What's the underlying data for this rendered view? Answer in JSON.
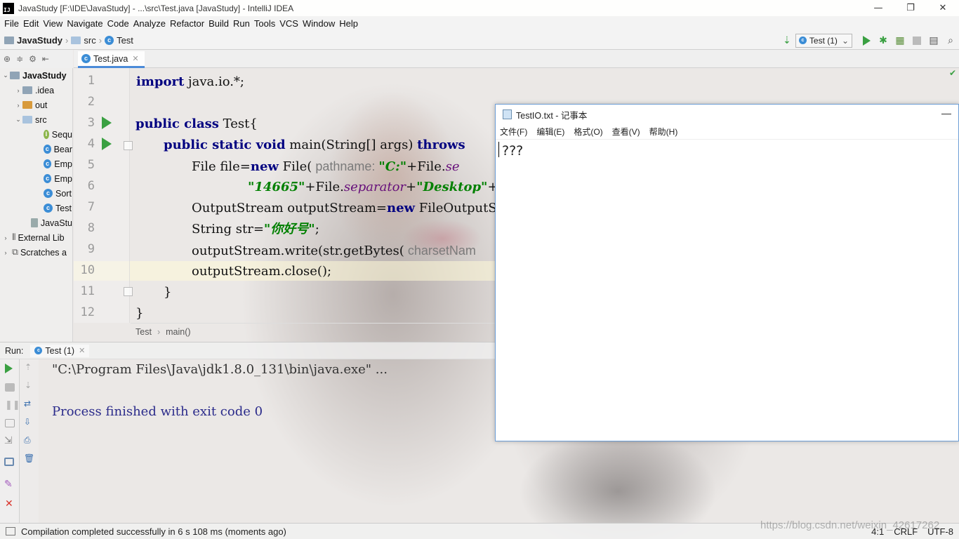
{
  "window": {
    "title": "JavaStudy [F:\\IDE\\JavaStudy] - ...\\src\\Test.java [JavaStudy] - IntelliJ IDEA",
    "logo": "IJ"
  },
  "menu": [
    "File",
    "Edit",
    "View",
    "Navigate",
    "Code",
    "Analyze",
    "Refactor",
    "Build",
    "Run",
    "Tools",
    "VCS",
    "Window",
    "Help"
  ],
  "breadcrumb": {
    "project": "JavaStudy",
    "folder": "src",
    "file": "Test"
  },
  "run_config": "Test (1)",
  "project_tree": [
    {
      "label": "JavaStudy",
      "indent": 0,
      "arrow": "v",
      "icon": "project"
    },
    {
      "label": ".idea",
      "indent": 1,
      "arrow": ">",
      "icon": "folder"
    },
    {
      "label": "out",
      "indent": 1,
      "arrow": ">",
      "icon": "folder-orange"
    },
    {
      "label": "src",
      "indent": 1,
      "arrow": "v",
      "icon": "folder-blue"
    },
    {
      "label": "Sequ",
      "indent": 2,
      "arrow": "",
      "icon": "interface"
    },
    {
      "label": "Bear",
      "indent": 2,
      "arrow": "",
      "icon": "class"
    },
    {
      "label": "Emp",
      "indent": 2,
      "arrow": "",
      "icon": "class"
    },
    {
      "label": "Emp",
      "indent": 2,
      "arrow": "",
      "icon": "class"
    },
    {
      "label": "Sort",
      "indent": 2,
      "arrow": "",
      "icon": "class"
    },
    {
      "label": "Test",
      "indent": 2,
      "arrow": "",
      "icon": "class-run"
    },
    {
      "label": "JavaStu",
      "indent": 1,
      "arrow": "",
      "icon": "file"
    },
    {
      "label": "External Lib",
      "indent": 0,
      "arrow": ">",
      "icon": "library"
    },
    {
      "label": "Scratches a",
      "indent": 0,
      "arrow": ">",
      "icon": "scratch"
    }
  ],
  "editor": {
    "tab": "Test.java",
    "line_numbers": [
      "1",
      "2",
      "3",
      "4",
      "5",
      "6",
      "7",
      "8",
      "9",
      "10",
      "11",
      "12"
    ],
    "crumb_class": "Test",
    "crumb_method": "main()"
  },
  "code": {
    "l1_kw": "import",
    "l1_rest": " java.io.*;",
    "l3_kw": "public class",
    "l3_rest": " Test{",
    "l4_kw": "public static void",
    "l4_mid": " main(String[] args) ",
    "l4_kw2": "throws",
    "l5_a": "File file=",
    "l5_kw": "new",
    "l5_b": " File(",
    "l5_hint": " pathname: ",
    "l5_str": "\"C:\"",
    "l5_c": "+File.",
    "l5_fld": "se",
    "l6_str": "\"14665\"",
    "l6_a": "+File.",
    "l6_fld": "separator",
    "l6_b": "+",
    "l6_str2": "\"Desktop\"",
    "l6_c": "+",
    "l7_a": "OutputStream outputStream=",
    "l7_kw": "new",
    "l7_b": " FileOutputStr",
    "l8_a": "String str=",
    "l8_str": "\"你好号\"",
    "l8_b": ";",
    "l9_a": "outputStream.write(str.getBytes(",
    "l9_hint": " charsetNam",
    "l10": "outputStream.close();",
    "l11": "}",
    "l12": "}"
  },
  "run_panel": {
    "label": "Run:",
    "tab": "Test (1)",
    "line1": "\"C:\\Program Files\\Java\\jdk1.8.0_131\\bin\\java.exe\" ...",
    "line2": "Process finished with exit code 0"
  },
  "status": {
    "message": "Compilation completed successfully in 6 s 108 ms (moments ago)",
    "position": "4:1",
    "line_sep": "CRLF",
    "encoding": "UTF-8",
    "watermark": "https://blog.csdn.net/weixin_42617262"
  },
  "notepad": {
    "title": "TestIO.txt - 记事本",
    "menu": [
      "文件(F)",
      "编辑(E)",
      "格式(O)",
      "查看(V)",
      "帮助(H)"
    ],
    "content": "???"
  }
}
